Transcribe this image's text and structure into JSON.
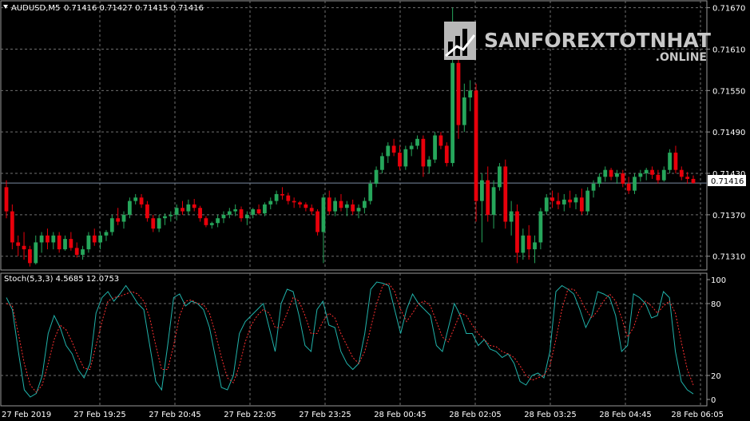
{
  "header": {
    "symbol": "AUDUSD,M5",
    "ohlc": "0.71416 0.71427 0.71415 0.71416",
    "indicator": "Stoch(5,3,3) 4.5685 12.0753"
  },
  "watermark": {
    "line1": "SANFOREXTOTNHAT",
    "line2": ".ONLINE"
  },
  "colors": {
    "background": "#000000",
    "bull": "#26a65b",
    "bear": "#e8000b",
    "grid": "#6f6f6f",
    "stoch_main": "#20b2aa",
    "stoch_signal": "#ff3030",
    "price_line": "#7a8aa0"
  },
  "chart_data": [
    {
      "type": "candlestick",
      "title": "AUDUSD,M5",
      "y_ticks": [
        "0.71670",
        "0.71610",
        "0.71550",
        "0.71490",
        "0.71430",
        "0.71370",
        "0.71310"
      ],
      "ylim": [
        0.7129,
        0.7168
      ],
      "current_price": "0.71416",
      "x_ticks": [
        "27 Feb 2019",
        "27 Feb 19:25",
        "27 Feb 20:45",
        "27 Feb 22:05",
        "27 Feb 23:25",
        "28 Feb 00:45",
        "28 Feb 02:05",
        "28 Feb 03:25",
        "28 Feb 04:45",
        "28 Feb 06:05"
      ],
      "grid": true,
      "candles": [
        [
          0.7141,
          0.7142,
          0.71365,
          0.71375
        ],
        [
          0.71375,
          0.71385,
          0.7132,
          0.7133
        ],
        [
          0.7133,
          0.7134,
          0.7131,
          0.71325
        ],
        [
          0.71325,
          0.71345,
          0.71305,
          0.7132
        ],
        [
          0.7132,
          0.71325,
          0.71295,
          0.713
        ],
        [
          0.713,
          0.7134,
          0.71298,
          0.7133
        ],
        [
          0.7133,
          0.71345,
          0.71315,
          0.7134
        ],
        [
          0.7134,
          0.7135,
          0.7132,
          0.7133
        ],
        [
          0.7133,
          0.71345,
          0.7132,
          0.7134
        ],
        [
          0.7134,
          0.71345,
          0.71315,
          0.7132
        ],
        [
          0.7132,
          0.7134,
          0.71318,
          0.71335
        ],
        [
          0.71335,
          0.71345,
          0.71318,
          0.71322
        ],
        [
          0.71322,
          0.7133,
          0.71308,
          0.71312
        ],
        [
          0.71312,
          0.71325,
          0.71305,
          0.7132
        ],
        [
          0.7132,
          0.71345,
          0.71315,
          0.7134
        ],
        [
          0.7134,
          0.7135,
          0.71325,
          0.7133
        ],
        [
          0.7133,
          0.71345,
          0.7132,
          0.7134
        ],
        [
          0.7134,
          0.71348,
          0.71332,
          0.71345
        ],
        [
          0.71345,
          0.7137,
          0.7134,
          0.71365
        ],
        [
          0.71365,
          0.7138,
          0.71355,
          0.7136
        ],
        [
          0.7136,
          0.71375,
          0.7135,
          0.7137
        ],
        [
          0.7137,
          0.71395,
          0.71365,
          0.7139
        ],
        [
          0.7139,
          0.714,
          0.71385,
          0.71395
        ],
        [
          0.71395,
          0.714,
          0.7138,
          0.71385
        ],
        [
          0.71385,
          0.7139,
          0.7136,
          0.71365
        ],
        [
          0.71365,
          0.7137,
          0.71345,
          0.7135
        ],
        [
          0.7135,
          0.7137,
          0.71345,
          0.71365
        ],
        [
          0.71365,
          0.71372,
          0.71355,
          0.71368
        ],
        [
          0.71368,
          0.71375,
          0.7136,
          0.7137
        ],
        [
          0.7137,
          0.71385,
          0.71362,
          0.7138
        ],
        [
          0.7138,
          0.7139,
          0.7137,
          0.71375
        ],
        [
          0.71375,
          0.71392,
          0.7137,
          0.71385
        ],
        [
          0.71385,
          0.71393,
          0.71375,
          0.7138
        ],
        [
          0.7138,
          0.71383,
          0.7136,
          0.71365
        ],
        [
          0.71365,
          0.71368,
          0.71352,
          0.71355
        ],
        [
          0.71355,
          0.7136,
          0.7135,
          0.71358
        ],
        [
          0.71358,
          0.7137,
          0.71352,
          0.71365
        ],
        [
          0.71365,
          0.71375,
          0.71358,
          0.7137
        ],
        [
          0.7137,
          0.7138,
          0.71365,
          0.71375
        ],
        [
          0.71375,
          0.71385,
          0.71368,
          0.71378
        ],
        [
          0.71378,
          0.71382,
          0.7136,
          0.71365
        ],
        [
          0.71365,
          0.71375,
          0.71355,
          0.7137
        ],
        [
          0.7137,
          0.7138,
          0.71365,
          0.71378
        ],
        [
          0.71378,
          0.71385,
          0.7137,
          0.71372
        ],
        [
          0.71372,
          0.71388,
          0.71368,
          0.71385
        ],
        [
          0.71385,
          0.71395,
          0.71378,
          0.7139
        ],
        [
          0.7139,
          0.71405,
          0.71385,
          0.714
        ],
        [
          0.714,
          0.7141,
          0.71392,
          0.71398
        ],
        [
          0.71398,
          0.71402,
          0.71385,
          0.7139
        ],
        [
          0.7139,
          0.71395,
          0.7138,
          0.71388
        ],
        [
          0.71388,
          0.7139,
          0.7138,
          0.71385
        ],
        [
          0.71385,
          0.71388,
          0.71375,
          0.7138
        ],
        [
          0.7138,
          0.71385,
          0.7137,
          0.71375
        ],
        [
          0.71375,
          0.71378,
          0.7134,
          0.71345
        ],
        [
          0.71345,
          0.714,
          0.713,
          0.71395
        ],
        [
          0.71395,
          0.71405,
          0.7137,
          0.71375
        ],
        [
          0.71375,
          0.71395,
          0.71368,
          0.7139
        ],
        [
          0.7139,
          0.714,
          0.71375,
          0.7138
        ],
        [
          0.7138,
          0.7139,
          0.71368,
          0.71385
        ],
        [
          0.71385,
          0.71392,
          0.7137,
          0.71375
        ],
        [
          0.71375,
          0.71385,
          0.71365,
          0.7138
        ],
        [
          0.7138,
          0.71395,
          0.71372,
          0.7139
        ],
        [
          0.7139,
          0.7142,
          0.71385,
          0.71415
        ],
        [
          0.71415,
          0.7144,
          0.7141,
          0.71435
        ],
        [
          0.71435,
          0.7146,
          0.7143,
          0.71455
        ],
        [
          0.71455,
          0.71475,
          0.71445,
          0.7147
        ],
        [
          0.7147,
          0.7148,
          0.71455,
          0.7146
        ],
        [
          0.7146,
          0.7147,
          0.71435,
          0.7144
        ],
        [
          0.7144,
          0.7147,
          0.71435,
          0.71465
        ],
        [
          0.71465,
          0.71475,
          0.71455,
          0.7147
        ],
        [
          0.7147,
          0.71485,
          0.71465,
          0.7148
        ],
        [
          0.7148,
          0.71485,
          0.71425,
          0.7144
        ],
        [
          0.7144,
          0.71455,
          0.7143,
          0.7145
        ],
        [
          0.7145,
          0.7149,
          0.71445,
          0.71485
        ],
        [
          0.71485,
          0.7149,
          0.71465,
          0.7147
        ],
        [
          0.7147,
          0.71475,
          0.7144,
          0.71445
        ],
        [
          0.71445,
          0.7167,
          0.7144,
          0.7159
        ],
        [
          0.7159,
          0.7162,
          0.7148,
          0.715
        ],
        [
          0.715,
          0.7156,
          0.7149,
          0.7154
        ],
        [
          0.7154,
          0.71565,
          0.7152,
          0.7155
        ],
        [
          0.7155,
          0.7156,
          0.7136,
          0.7139
        ],
        [
          0.7139,
          0.7143,
          0.7133,
          0.7142
        ],
        [
          0.7142,
          0.7144,
          0.7136,
          0.7137
        ],
        [
          0.7137,
          0.7142,
          0.7135,
          0.7141
        ],
        [
          0.7141,
          0.71445,
          0.71405,
          0.7144
        ],
        [
          0.7144,
          0.7145,
          0.7135,
          0.7136
        ],
        [
          0.7136,
          0.7139,
          0.7134,
          0.71375
        ],
        [
          0.71375,
          0.71385,
          0.713,
          0.71315
        ],
        [
          0.71315,
          0.7135,
          0.71305,
          0.7134
        ],
        [
          0.7134,
          0.71355,
          0.71305,
          0.7132
        ],
        [
          0.7132,
          0.7134,
          0.713,
          0.7133
        ],
        [
          0.7133,
          0.7138,
          0.7132,
          0.71375
        ],
        [
          0.71375,
          0.714,
          0.7137,
          0.71395
        ],
        [
          0.71395,
          0.71405,
          0.7138,
          0.7139
        ],
        [
          0.7139,
          0.71402,
          0.71378,
          0.71385
        ],
        [
          0.71385,
          0.714,
          0.71375,
          0.71392
        ],
        [
          0.71392,
          0.71405,
          0.7138,
          0.71388
        ],
        [
          0.71388,
          0.714,
          0.71378,
          0.71395
        ],
        [
          0.71395,
          0.71408,
          0.7137,
          0.71375
        ],
        [
          0.71375,
          0.7141,
          0.7137,
          0.71405
        ],
        [
          0.71405,
          0.7142,
          0.71395,
          0.71415
        ],
        [
          0.71415,
          0.7143,
          0.7141,
          0.71425
        ],
        [
          0.71425,
          0.7144,
          0.71418,
          0.71435
        ],
        [
          0.71435,
          0.71438,
          0.7142,
          0.71425
        ],
        [
          0.71425,
          0.71435,
          0.71415,
          0.7143
        ],
        [
          0.7143,
          0.71435,
          0.7141,
          0.71415
        ],
        [
          0.71415,
          0.71425,
          0.714,
          0.71405
        ],
        [
          0.71405,
          0.7143,
          0.714,
          0.71425
        ],
        [
          0.71425,
          0.71435,
          0.71418,
          0.7143
        ],
        [
          0.7143,
          0.71438,
          0.7142,
          0.71435
        ],
        [
          0.71435,
          0.7144,
          0.71422,
          0.71428
        ],
        [
          0.71428,
          0.71435,
          0.71415,
          0.7142
        ],
        [
          0.7142,
          0.7144,
          0.71418,
          0.71435
        ],
        [
          0.71435,
          0.71465,
          0.7143,
          0.7146
        ],
        [
          0.7146,
          0.7147,
          0.7143,
          0.71435
        ],
        [
          0.71435,
          0.7144,
          0.7142,
          0.71425
        ],
        [
          0.71425,
          0.71432,
          0.71415,
          0.71422
        ],
        [
          0.71422,
          0.71427,
          0.71415,
          0.71416
        ]
      ]
    },
    {
      "type": "line",
      "title": "Stoch(5,3,3) 4.5685 12.0753",
      "y_ticks": [
        "100",
        "80",
        "20",
        "0"
      ],
      "ylim": [
        0,
        100
      ],
      "levels": [
        80,
        20
      ],
      "grid": true,
      "series": [
        {
          "name": "Stoch main",
          "values": [
            85,
            75,
            40,
            8,
            2,
            5,
            20,
            55,
            70,
            60,
            45,
            38,
            25,
            18,
            30,
            72,
            85,
            90,
            82,
            88,
            95,
            88,
            80,
            75,
            45,
            15,
            8,
            45,
            85,
            88,
            78,
            82,
            80,
            75,
            60,
            35,
            10,
            8,
            20,
            55,
            65,
            70,
            75,
            80,
            60,
            40,
            80,
            92,
            90,
            70,
            45,
            40,
            75,
            82,
            62,
            60,
            40,
            30,
            25,
            30,
            55,
            92,
            98,
            97,
            95,
            75,
            55,
            75,
            88,
            80,
            75,
            70,
            45,
            40,
            60,
            80,
            70,
            55,
            55,
            45,
            50,
            42,
            40,
            35,
            38,
            30,
            15,
            12,
            20,
            22,
            18,
            40,
            90,
            95,
            92,
            88,
            75,
            60,
            70,
            90,
            88,
            85,
            70,
            40,
            45,
            88,
            85,
            80,
            68,
            70,
            90,
            85,
            40,
            15,
            8,
            4.5685
          ]
        },
        {
          "name": "Stoch signal",
          "values": [
            80,
            78,
            55,
            30,
            12,
            6,
            12,
            30,
            50,
            62,
            58,
            48,
            36,
            26,
            25,
            45,
            65,
            82,
            85,
            86,
            88,
            90,
            88,
            82,
            68,
            45,
            25,
            25,
            45,
            70,
            82,
            83,
            80,
            79,
            72,
            55,
            35,
            18,
            14,
            28,
            48,
            62,
            70,
            75,
            72,
            60,
            60,
            72,
            85,
            82,
            70,
            55,
            55,
            65,
            72,
            68,
            55,
            45,
            35,
            30,
            40,
            60,
            80,
            95,
            97,
            90,
            75,
            65,
            72,
            80,
            82,
            78,
            65,
            52,
            48,
            60,
            72,
            70,
            62,
            55,
            50,
            45,
            44,
            40,
            38,
            35,
            28,
            20,
            16,
            18,
            20,
            28,
            50,
            75,
            92,
            92,
            85,
            75,
            68,
            74,
            82,
            88,
            82,
            68,
            52,
            60,
            75,
            82,
            78,
            72,
            78,
            82,
            72,
            48,
            25,
            12.0753
          ]
        }
      ]
    }
  ]
}
